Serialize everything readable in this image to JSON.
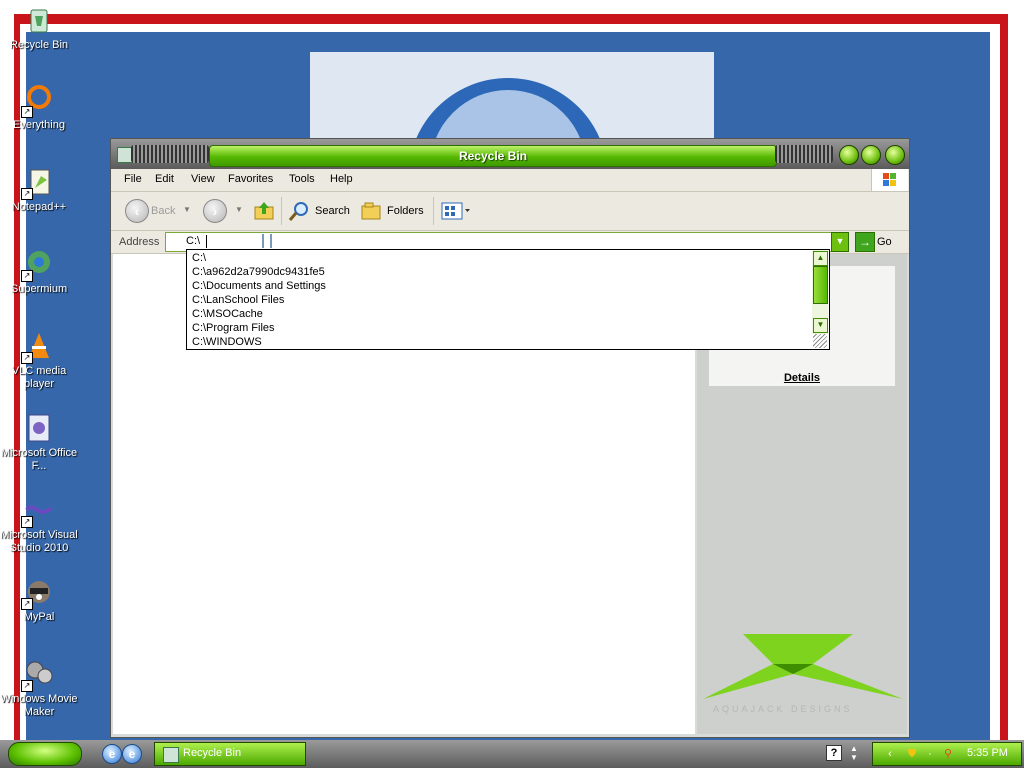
{
  "desktop": {
    "icons": [
      {
        "label": "Recycle Bin"
      },
      {
        "label": "Everything"
      },
      {
        "label": "Notepad++"
      },
      {
        "label": "Supermium"
      },
      {
        "label": "VLC media player"
      },
      {
        "label": "Microsoft Office F..."
      },
      {
        "label": "Microsoft Visual Studio 2010"
      },
      {
        "label": "MyPal"
      },
      {
        "label": "Windows Movie Maker"
      }
    ]
  },
  "window": {
    "title": "Recycle Bin",
    "menu": [
      "File",
      "Edit",
      "View",
      "Favorites",
      "Tools",
      "Help"
    ],
    "toolbar": {
      "back": "Back",
      "search": "Search",
      "folders": "Folders"
    },
    "address": {
      "label": "Address",
      "value": "C:\\",
      "go": "Go"
    },
    "autocomplete": [
      "C:\\",
      "C:\\a962d2a7990dc9431fe5",
      "C:\\Documents and Settings",
      "C:\\LanSchool Files",
      "C:\\MSOCache",
      "C:\\Program Files",
      "C:\\WINDOWS"
    ],
    "details_heading": "Details",
    "brand_text": "AQUAJACK DESIGNS",
    "accent_color": "#55b800"
  },
  "taskbar": {
    "task_label": "Recycle Bin",
    "clock": "5:35 PM"
  }
}
